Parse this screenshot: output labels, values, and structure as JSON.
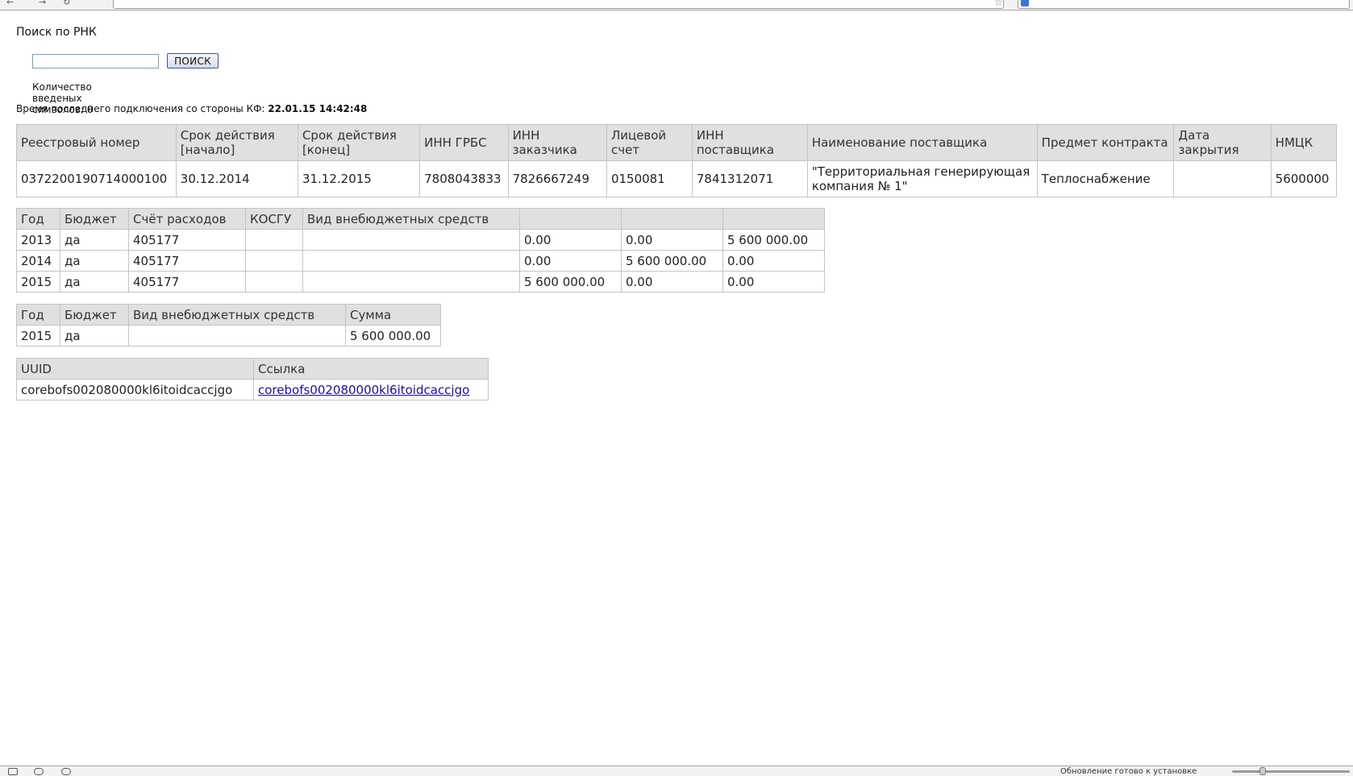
{
  "page": {
    "title": "Поиск по РНК",
    "search_placeholder": "",
    "search_value": "",
    "search_button": "ПОИСК",
    "counter_label": "Количество введеных символов: 0",
    "last_connection_label": "Время последнего подключения со стороны КФ:",
    "last_connection_value": "22.01.15 14:42:48"
  },
  "main_table": {
    "headers": [
      "Реестровый номер",
      "Срок действия [начало]",
      "Срок действия [конец]",
      "ИНН ГРБС",
      "ИНН заказчика",
      "Лицевой счет",
      "ИНН поставщика",
      "Наименование поставщика",
      "Предмет контракта",
      "Дата закрытия",
      "НМЦК"
    ],
    "rows": [
      [
        "0372200190714000100",
        "30.12.2014",
        "31.12.2015",
        "7808043833",
        "7826667249",
        "0150081",
        "7841312071",
        "\"Территориальная генерирующая компания № 1\"",
        "Теплоснабжение",
        "",
        "5600000"
      ]
    ]
  },
  "years_table": {
    "headers": [
      "Год",
      "Бюджет",
      "Счёт расходов",
      "КОСГУ",
      "Вид внебюджетных средств",
      "",
      "",
      ""
    ],
    "rows": [
      [
        "2013",
        "да",
        "405177",
        "",
        "",
        "0.00",
        "0.00",
        "5 600 000.00"
      ],
      [
        "2014",
        "да",
        "405177",
        "",
        "",
        "0.00",
        "5 600 000.00",
        "0.00"
      ],
      [
        "2015",
        "да",
        "405177",
        "",
        "",
        "5 600 000.00",
        "0.00",
        "0.00"
      ]
    ]
  },
  "sum_table": {
    "headers": [
      "Год",
      "Бюджет",
      "Вид внебюджетных средств",
      "Сумма"
    ],
    "rows": [
      [
        "2015",
        "да",
        "",
        "5 600 000.00"
      ]
    ]
  },
  "uuid_table": {
    "headers": [
      "UUID",
      "Ссылка"
    ],
    "rows": [
      [
        "corebofs002080000kl6itoidcaccjgo",
        "corebofs002080000kl6itoidcaccjgo"
      ]
    ]
  },
  "status_bar": {
    "message": "Обновление готово к установке"
  }
}
